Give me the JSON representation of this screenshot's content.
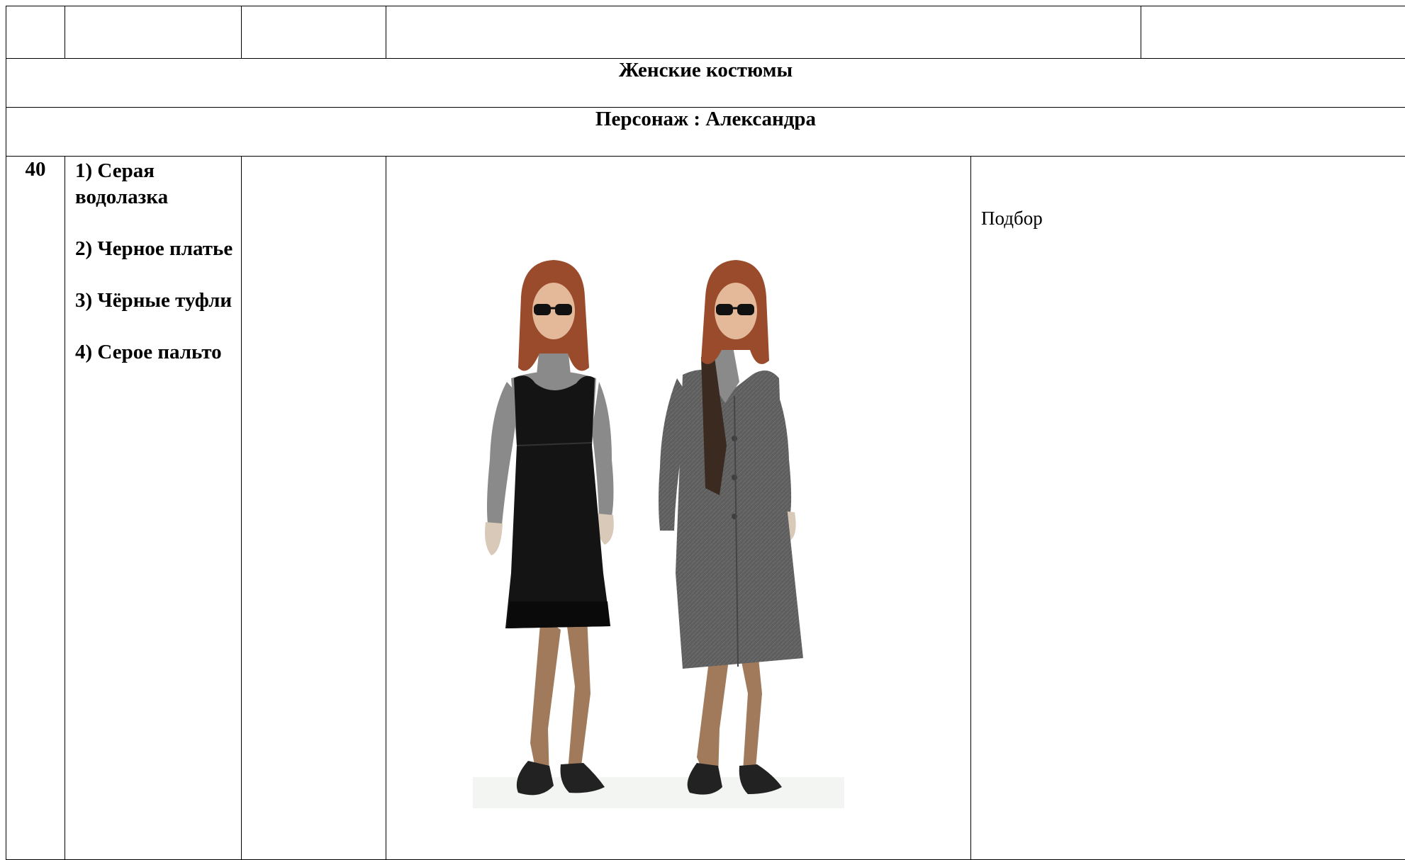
{
  "document": {
    "section_title": "Женские костюмы",
    "character_heading": "Персонаж : Александра"
  },
  "entry": {
    "number": "40",
    "items": [
      "1) Серая водолазка",
      "2) Черное платье",
      "3) Чёрные туфли",
      "4)  Серое пальто"
    ],
    "note": "Подбор"
  },
  "colors": {
    "dress": "#141414",
    "turtleneck": "#8a8a8a",
    "coat": "#5e5e5e",
    "hair": "#9a4b2c",
    "skin": "#e4b99a",
    "tights": "#a07a5a"
  }
}
